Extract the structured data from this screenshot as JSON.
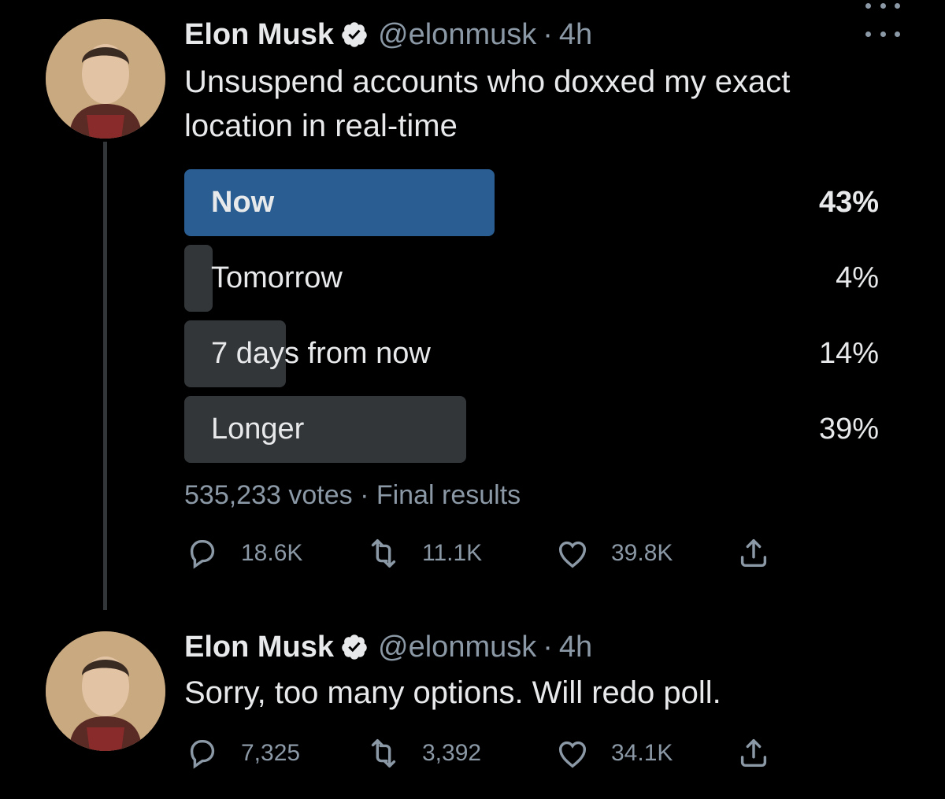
{
  "tweets": [
    {
      "author_name": "Elon Musk",
      "handle": "@elonmusk",
      "separator": "·",
      "time": "4h",
      "text": "Unsuspend accounts who doxxed my exact location in real-time",
      "poll": {
        "options": [
          {
            "label": "Now",
            "percent_label": "43%",
            "percent": 43,
            "winner": true
          },
          {
            "label": "Tomorrow",
            "percent_label": "4%",
            "percent": 4,
            "winner": false
          },
          {
            "label": "7 days from now",
            "percent_label": "14%",
            "percent": 14,
            "winner": false
          },
          {
            "label": "Longer",
            "percent_label": "39%",
            "percent": 39,
            "winner": false
          }
        ],
        "votes": "535,233 votes",
        "separator": "·",
        "status": "Final results"
      },
      "metrics": {
        "replies": "18.6K",
        "retweets": "11.1K",
        "likes": "39.8K"
      },
      "icons": [
        "verified-badge-icon",
        "more-options-icon",
        "reply-icon",
        "retweet-icon",
        "like-icon",
        "share-icon"
      ]
    },
    {
      "author_name": "Elon Musk",
      "handle": "@elonmusk",
      "separator": "·",
      "time": "4h",
      "text": "Sorry, too many options. Will redo poll.",
      "metrics": {
        "replies": "7,325",
        "retweets": "3,392",
        "likes": "34.1K"
      },
      "icons": [
        "verified-badge-icon",
        "more-options-icon",
        "reply-icon",
        "retweet-icon",
        "like-icon",
        "share-icon"
      ]
    }
  ],
  "colors": {
    "background": "#000000",
    "text": "#e7e9ea",
    "muted": "#8b98a5",
    "poll_winner_bar": "#2a5d91",
    "poll_bar": "#333639"
  }
}
